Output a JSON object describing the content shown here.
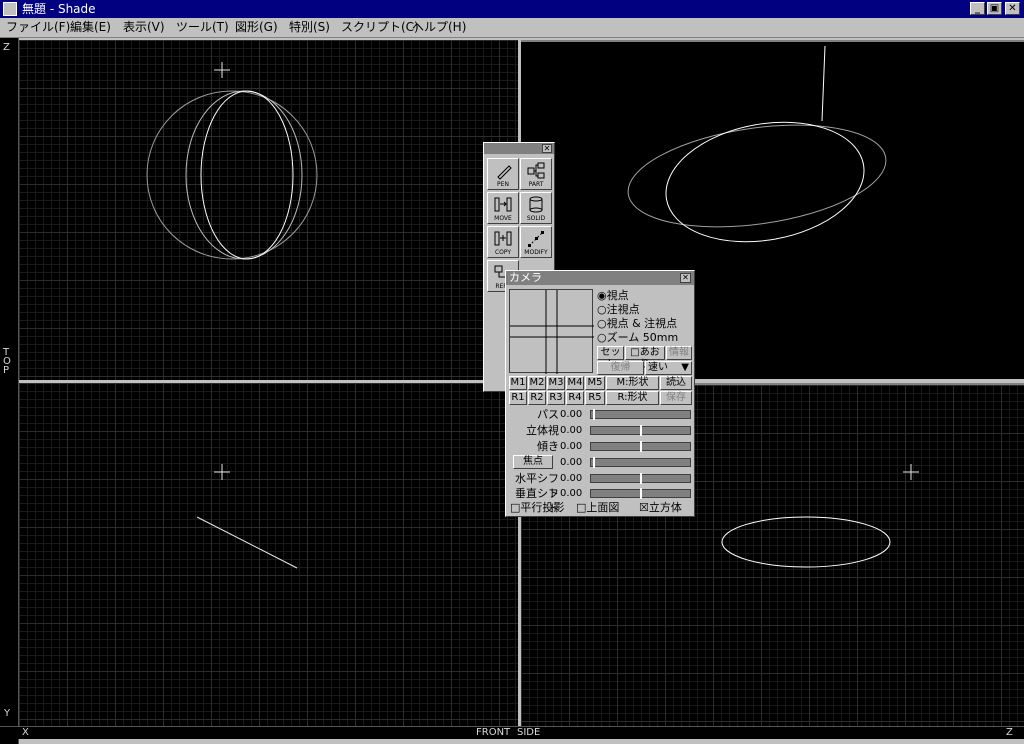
{
  "window": {
    "title": "無題 - Shade",
    "min": "_",
    "restore": "▣",
    "close": "✕"
  },
  "menu": [
    "ファイル(F)",
    "編集(E)",
    "表示(V)",
    "ツール(T)",
    "図形(G)",
    "特別(S)",
    "スクリプト(C)",
    "ヘルプ(H)"
  ],
  "rulers": {
    "z_top": "Z",
    "top": "TOP",
    "y_bottom": "Y",
    "x": "X",
    "front": "FRONT",
    "side": "SIDE",
    "z_right": "Z"
  },
  "tool_palette": {
    "close": "✕",
    "buttons": [
      {
        "label": "PEN",
        "icon": "pen-icon"
      },
      {
        "label": "PART",
        "icon": "part-icon"
      },
      {
        "label": "MOVE",
        "icon": "move-icon"
      },
      {
        "label": "SOLID",
        "icon": "solid-icon"
      },
      {
        "label": "COPY",
        "icon": "copy-icon"
      },
      {
        "label": "MODIFY",
        "icon": "modify-icon"
      },
      {
        "label": "REPE",
        "icon": "repeat-icon"
      }
    ]
  },
  "camera": {
    "title": "カメラ",
    "close": "✕",
    "radios": [
      {
        "label": "視点",
        "checked": true
      },
      {
        "label": "注視点",
        "checked": false
      },
      {
        "label": "視点 & 注視点",
        "checked": false
      },
      {
        "label": "ズーム   50mm",
        "checked": false
      }
    ],
    "btn_set": "セット",
    "btn_aori": "□あおり",
    "btn_info": "情報",
    "btn_restore": "復帰",
    "speed": "速い",
    "memory_row1": [
      "M1",
      "M2",
      "M3",
      "M4",
      "M5",
      "M:形状",
      "読込"
    ],
    "memory_row2": [
      "R1",
      "R2",
      "R3",
      "R4",
      "R5",
      "R:形状",
      "保存"
    ],
    "sliders": [
      {
        "name": "パス",
        "value": "0.00",
        "knob": 0.02
      },
      {
        "name": "立体視",
        "value": "0.00",
        "knob": 0.5
      },
      {
        "name": "傾き",
        "value": "0.00",
        "knob": 0.5
      },
      {
        "name": "焦点",
        "value": "0.00",
        "knob": 0.02
      },
      {
        "name": "水平シフト",
        "value": "0.00",
        "knob": 0.5
      },
      {
        "name": "垂直シフト",
        "value": "0.00",
        "knob": 0.5
      }
    ],
    "chk_parallel": "□平行投影",
    "chk_topview": "□上面図",
    "chk_cube": "☒立方体"
  }
}
